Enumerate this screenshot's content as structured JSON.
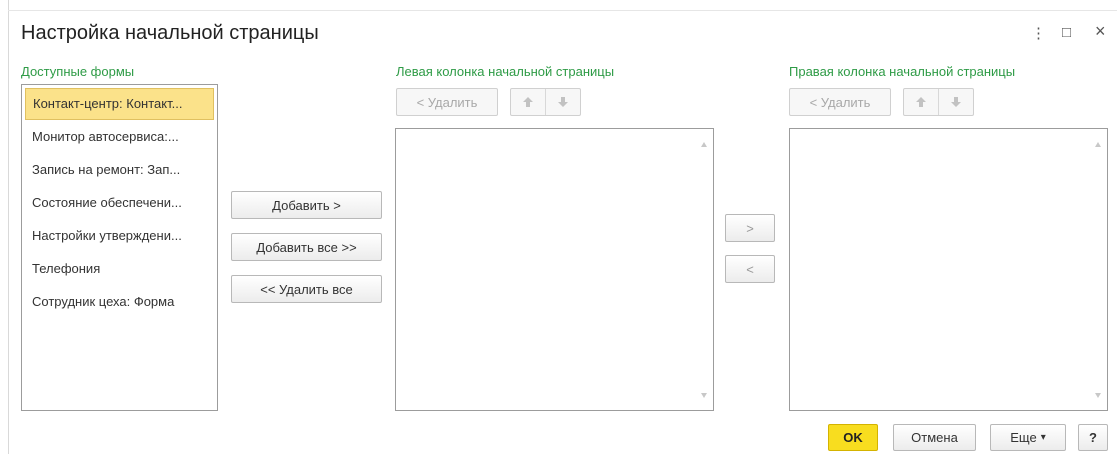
{
  "window": {
    "title": "Настройка начальной страницы",
    "menu_icon": "⋮",
    "maximize_icon": "□",
    "close_icon": "×"
  },
  "available": {
    "label": "Доступные формы",
    "items": [
      "Контакт-центр: Контакт...",
      "Монитор автосервиса:...",
      "Запись на ремонт: Зап...",
      "Состояние обеспечени...",
      "Настройки утверждени...",
      "Телефония",
      "Сотрудник цеха: Форма"
    ],
    "selected_index": 0
  },
  "transfer": {
    "add": "Добавить >",
    "add_all": "Добавить все >>",
    "remove_all": "<< Удалить все"
  },
  "left_column": {
    "label": "Левая колонка начальной страницы",
    "remove": "< Удалить",
    "up_icon": "arrow-up-icon",
    "down_icon": "arrow-down-icon"
  },
  "move": {
    "right": ">",
    "left": "<"
  },
  "right_column": {
    "label": "Правая колонка начальной страницы",
    "remove": "< Удалить",
    "up_icon": "arrow-up-icon",
    "down_icon": "arrow-down-icon"
  },
  "footer": {
    "ok": "OK",
    "cancel": "Отмена",
    "more": "Еще",
    "more_arrow": "▾",
    "help": "?"
  },
  "colors": {
    "group_label": "#2e9b46",
    "selection": "#fbe28a",
    "ok_button": "#f8dd1f"
  }
}
